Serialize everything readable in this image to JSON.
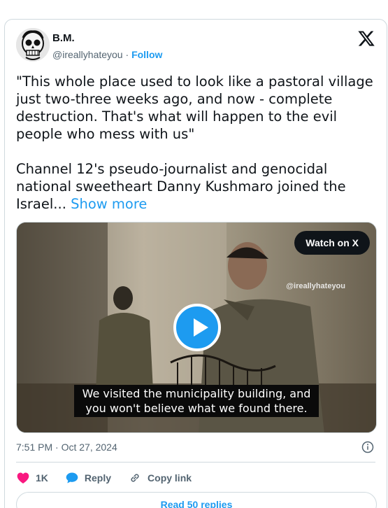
{
  "author": {
    "name": "B.M.",
    "handle": "@ireallyhateyou",
    "separator": "·",
    "follow_label": "Follow"
  },
  "tweet": {
    "text": "\"This whole place used to look like a pastoral village just two-three weeks ago, and now - complete destruction. That's what will happen to the evil people who mess with us\"\n\nChannel 12's pseudo-journalist and genocidal national sweetheart Danny Kushmaro joined the Israel... ",
    "show_more_label": "Show more"
  },
  "media": {
    "watch_label": "Watch on X",
    "watermark": "@ireallyhateyou",
    "caption": "We visited the municipality building, and you won't believe what we found there."
  },
  "timestamp": "7:51 PM · Oct 27, 2024",
  "actions": {
    "likes": "1K",
    "reply_label": "Reply",
    "copy_label": "Copy link"
  },
  "replies": {
    "read_label": "Read 50 replies"
  },
  "colors": {
    "accent": "#1d9bf0",
    "like": "#f91880",
    "muted": "#536471"
  },
  "icons": [
    "x-logo-icon",
    "play-icon",
    "info-icon",
    "heart-icon",
    "reply-bubble-icon",
    "link-icon"
  ]
}
